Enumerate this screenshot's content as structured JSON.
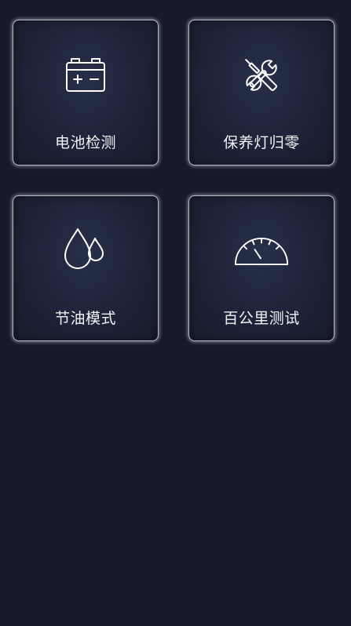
{
  "tiles": [
    {
      "label": "电池检测",
      "icon": "battery-icon"
    },
    {
      "label": "保养灯归零",
      "icon": "wrench-screwdriver-icon"
    },
    {
      "label": "节油模式",
      "icon": "oil-drops-icon"
    },
    {
      "label": "百公里测试",
      "icon": "speedometer-icon"
    }
  ],
  "colors": {
    "background": "#161a2b",
    "tile_border": "#b6b9c2",
    "icon_and_text": "#ffffff"
  }
}
